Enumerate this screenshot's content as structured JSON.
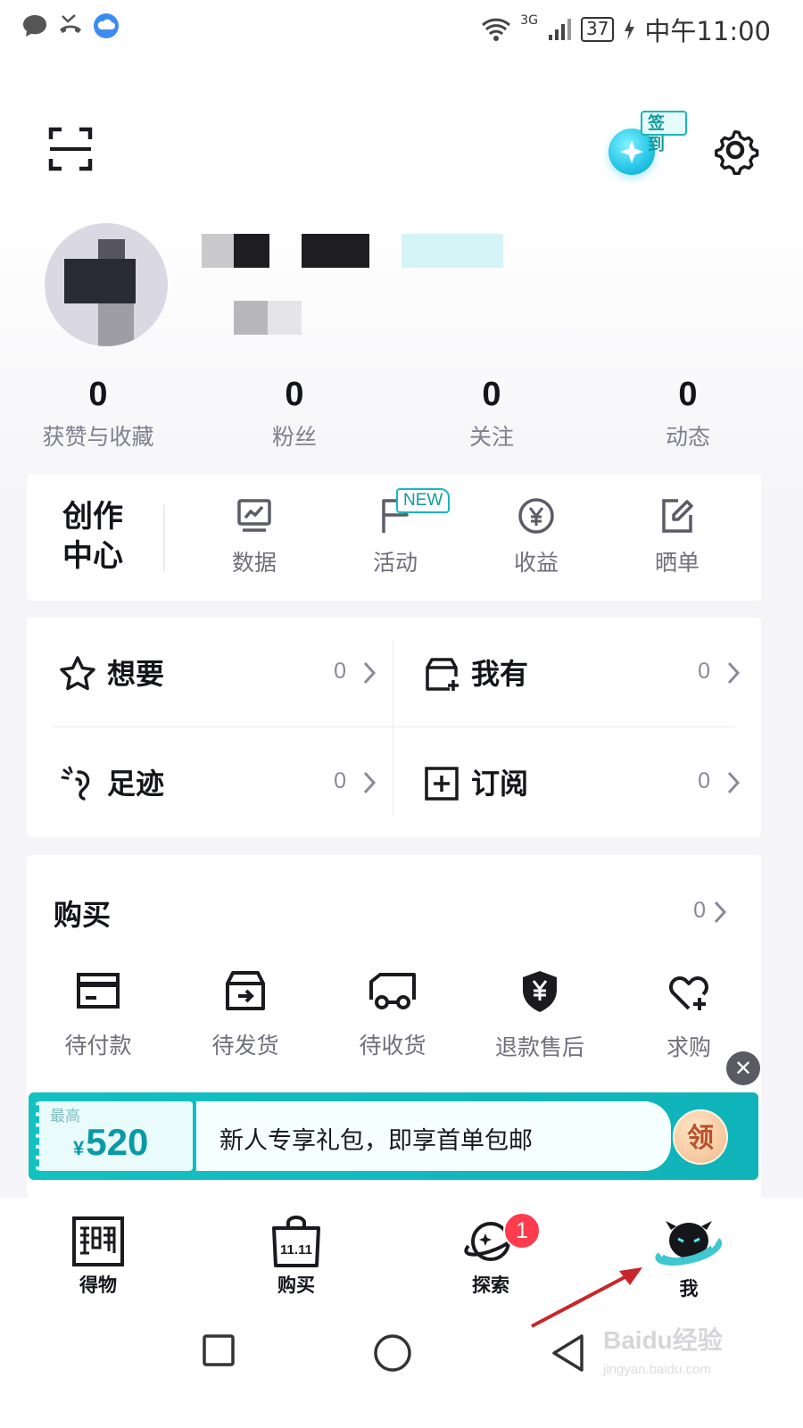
{
  "status_bar": {
    "battery": "37",
    "network": "3G",
    "time": "中午11:00"
  },
  "header": {
    "checkin_label": "签到"
  },
  "stats": [
    {
      "value": "0",
      "label": "获赞与收藏"
    },
    {
      "value": "0",
      "label": "粉丝"
    },
    {
      "value": "0",
      "label": "关注"
    },
    {
      "value": "0",
      "label": "动态"
    }
  ],
  "creator_center": {
    "title_line1": "创作",
    "title_line2": "中心",
    "items": [
      {
        "label": "数据",
        "icon": "chart-board-icon"
      },
      {
        "label": "活动",
        "icon": "flag-icon",
        "badge": "NEW"
      },
      {
        "label": "收益",
        "icon": "yuan-coin-icon"
      },
      {
        "label": "晒单",
        "icon": "edit-note-icon"
      }
    ]
  },
  "collections": [
    {
      "label": "想要",
      "count": "0",
      "icon": "star-icon"
    },
    {
      "label": "我有",
      "count": "0",
      "icon": "box-add-icon"
    },
    {
      "label": "足迹",
      "count": "0",
      "icon": "footprint-icon"
    },
    {
      "label": "订阅",
      "count": "0",
      "icon": "plus-square-icon"
    }
  ],
  "purchase": {
    "title": "购买",
    "count": "0",
    "items": [
      {
        "label": "待付款",
        "icon": "wallet-card-icon"
      },
      {
        "label": "待发货",
        "icon": "box-ship-icon"
      },
      {
        "label": "待收货",
        "icon": "truck-icon"
      },
      {
        "label": "退款售后",
        "icon": "yuan-shield-icon"
      },
      {
        "label": "求购",
        "icon": "heart-plus-icon"
      }
    ]
  },
  "promo": {
    "max_label": "最高",
    "currency": "¥",
    "amount": "520",
    "text": "新人专享礼包，即享首单包邮",
    "button": "领",
    "close": "✕"
  },
  "tabbar": {
    "items": [
      {
        "label": "得物",
        "icon": "dewu-logo-icon"
      },
      {
        "label": "购买",
        "icon": "shopping-bag-icon",
        "bag_text": "11.11"
      },
      {
        "label": "探索",
        "icon": "planet-icon",
        "badge": "1"
      },
      {
        "label": "我",
        "icon": "avatar-me-icon"
      }
    ]
  },
  "watermark": {
    "text": "Baidu经验",
    "sub": "jingyan.baidu.com"
  },
  "colors": {
    "accent": "#13c1c1",
    "badge_red": "#ff3b4e",
    "annotation_arrow": "#c8262b"
  }
}
